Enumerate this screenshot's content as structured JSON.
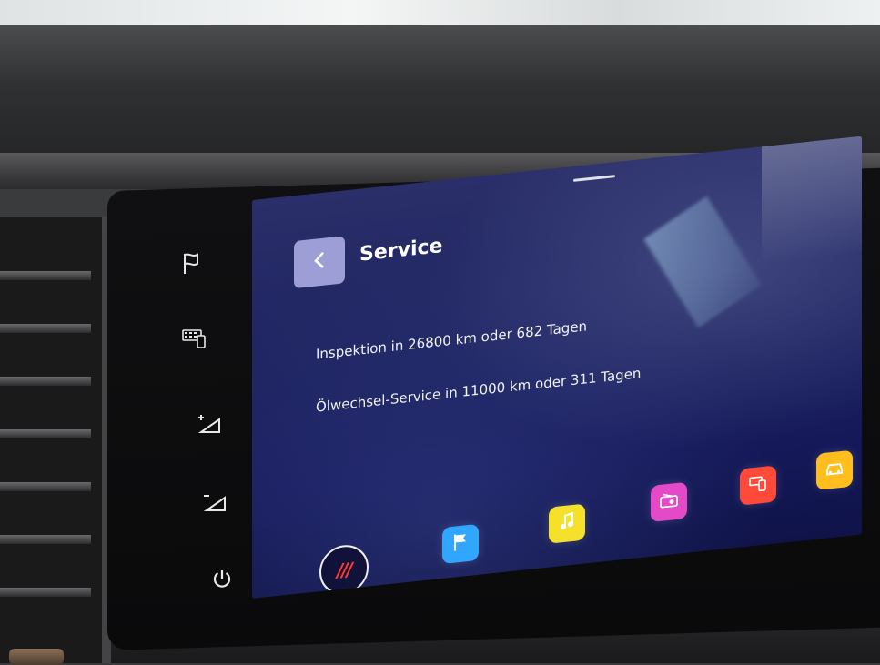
{
  "colors": {
    "screen_bg": "#1e2460",
    "back_button_bg": "#9d9ed6",
    "home_mark": "#ff3a2e",
    "text": "#ffffff"
  },
  "side_buttons": [
    {
      "name": "navigation-flag-icon"
    },
    {
      "name": "phone-keypad-icon"
    },
    {
      "name": "volume-up-icon"
    },
    {
      "name": "volume-down-icon"
    },
    {
      "name": "power-icon"
    }
  ],
  "header": {
    "back_icon": "chevron-left-icon",
    "title": "Service"
  },
  "service_info": {
    "inspection": "Inspektion in 26800 km oder 682 Tagen",
    "oil_change": "Ölwechsel-Service in 11000 km oder 311 Tagen"
  },
  "dock": {
    "home_label": "///",
    "apps": [
      {
        "name": "navigation-app",
        "color": "#31a6ff",
        "icon": "flag-icon"
      },
      {
        "name": "media-app",
        "color": "#f5e12a",
        "icon": "music-icon"
      },
      {
        "name": "radio-app",
        "color": "#e44ac8",
        "icon": "radio-icon"
      },
      {
        "name": "phone-app",
        "color": "#ff4a3a",
        "icon": "phone-icon"
      },
      {
        "name": "car-app",
        "color": "#ffbe1e",
        "icon": "car-icon"
      }
    ]
  }
}
